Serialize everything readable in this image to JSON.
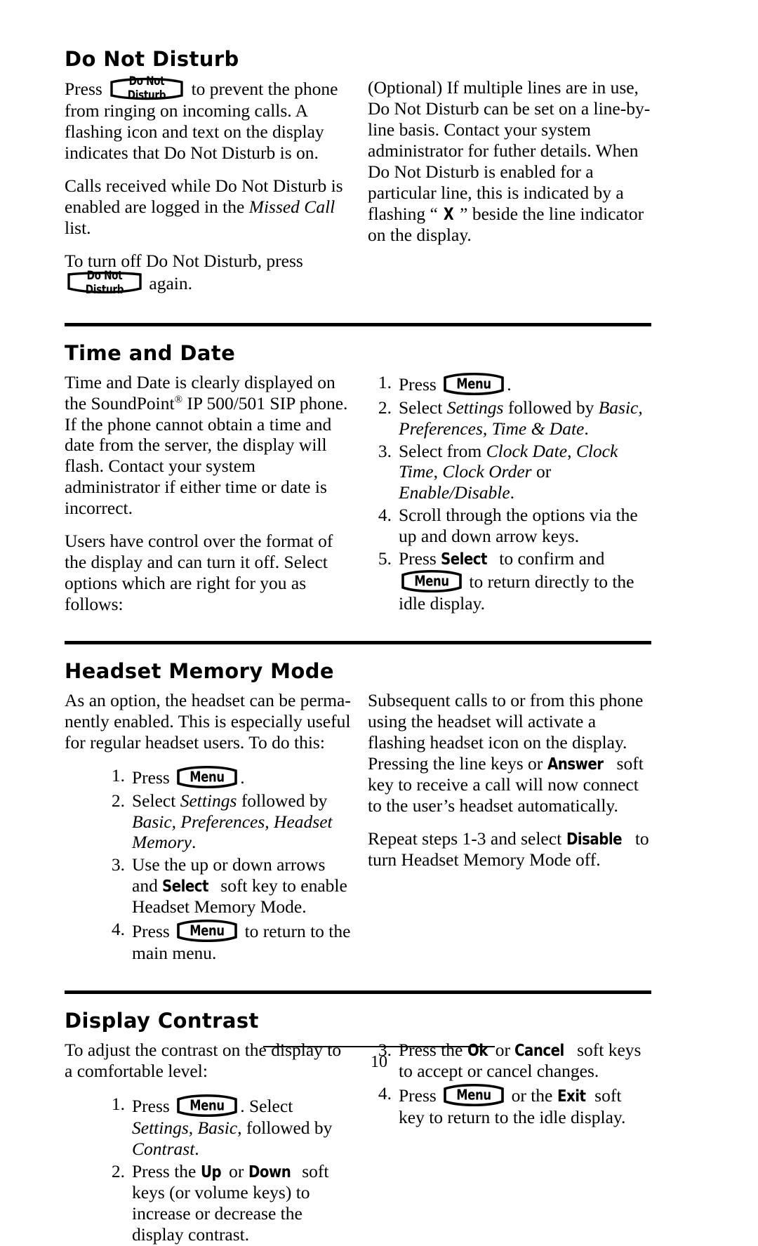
{
  "document": {
    "page_number": "10"
  },
  "keys": {
    "do_not_disturb": "Do Not Disturb",
    "menu": "Menu"
  },
  "sections": [
    {
      "id": "do-not-disturb",
      "heading": "Do Not Disturb",
      "has_rule_above": false,
      "left": {
        "p1_a": "Press ",
        "p1_b": " to prevent the phone from ringing on incoming calls.  A flashing icon and text on the display indicates that Do Not Disturb is on.",
        "p2_a": "Calls received while Do Not Disturb is enabled are logged in the ",
        "p2_i": "Missed Call",
        "p2_b": " list.",
        "p3_a": "To turn off Do Not Disturb, press ",
        "p3_b": " again."
      },
      "right": {
        "p1_a": "(Optional) If multiple lines are in use, Do Not Disturb can be set on a line-by-line basis.  Contact your system administrator for futher details.  When Do Not Disturb is enabled for a particular line, this is indicated by a flashing “ ",
        "p1_x": "X",
        "p1_b": " ” beside the line indicator on the display."
      }
    },
    {
      "id": "time-and-date",
      "heading": "Time and Date",
      "has_rule_above": true,
      "left": {
        "p1_a": "Time and Date is clearly displayed on the SoundPoint",
        "p1_reg": "®",
        "p1_b": " IP 500/501 SIP phone.  If the phone cannot obtain a time and date from the server, the display will flash.  Contact your system administrator if either time or date is incorrect.",
        "p2": "Users have control over the format of the display and can turn it off.  Select options which are right for you as follows:"
      },
      "right_steps": [
        {
          "num": "1.",
          "parts": [
            {
              "t": "text",
              "v": "Press "
            },
            {
              "t": "key",
              "v": "Menu"
            },
            {
              "t": "text",
              "v": "."
            }
          ]
        },
        {
          "num": "2.",
          "parts": [
            {
              "t": "text",
              "v": "Select "
            },
            {
              "t": "italic",
              "v": "Settings"
            },
            {
              "t": "text",
              "v": " followed by "
            },
            {
              "t": "italic",
              "v": "Basic, Preferences, Time & Date"
            },
            {
              "t": "text",
              "v": "."
            }
          ]
        },
        {
          "num": "3.",
          "parts": [
            {
              "t": "text",
              "v": "Select from "
            },
            {
              "t": "italic",
              "v": "Clock Date"
            },
            {
              "t": "text",
              "v": ", "
            },
            {
              "t": "italic",
              "v": "Clock Time"
            },
            {
              "t": "text",
              "v": ", "
            },
            {
              "t": "italic",
              "v": "Clock Order"
            },
            {
              "t": "text",
              "v": " or "
            },
            {
              "t": "italic",
              "v": "Enable/Disable"
            },
            {
              "t": "text",
              "v": "."
            }
          ]
        },
        {
          "num": "4.",
          "parts": [
            {
              "t": "text",
              "v": "Scroll through the options via the up and down arrow keys."
            }
          ]
        },
        {
          "num": "5.",
          "parts": [
            {
              "t": "text",
              "v": "Press "
            },
            {
              "t": "softkey",
              "v": "Select"
            },
            {
              "t": "text",
              "v": " to confirm and "
            },
            {
              "t": "key",
              "v": "Menu"
            },
            {
              "t": "text",
              "v": " to return directly to the idle display."
            }
          ]
        }
      ]
    },
    {
      "id": "headset-memory-mode",
      "heading": "Headset Memory Mode",
      "has_rule_above": true,
      "left": {
        "p1": "As an option, the headset can be perma-nently enabled.  This is especially useful for regular headset users.  To do this:"
      },
      "left_steps": [
        {
          "num": "1.",
          "parts": [
            {
              "t": "text",
              "v": "Press "
            },
            {
              "t": "key",
              "v": "Menu"
            },
            {
              "t": "text",
              "v": "."
            }
          ]
        },
        {
          "num": "2.",
          "parts": [
            {
              "t": "text",
              "v": "Select "
            },
            {
              "t": "italic",
              "v": "Settings"
            },
            {
              "t": "text",
              "v": " followed by "
            },
            {
              "t": "italic",
              "v": "Basic, Preferences, Headset Memory"
            },
            {
              "t": "text",
              "v": "."
            }
          ]
        },
        {
          "num": "3.",
          "parts": [
            {
              "t": "text",
              "v": "Use the up or down arrows and "
            },
            {
              "t": "softkey",
              "v": "Select"
            },
            {
              "t": "text",
              "v": " soft key to enable Headset Memory Mode."
            }
          ]
        },
        {
          "num": "4.",
          "parts": [
            {
              "t": "text",
              "v": "Press "
            },
            {
              "t": "key",
              "v": "Menu"
            },
            {
              "t": "text",
              "v": " to return to the main menu."
            }
          ]
        }
      ],
      "right": {
        "p1_a": "Subsequent calls to or from this phone using the headset will activate a flashing headset icon on the display.  Pressing the line keys or ",
        "p1_key": "Answer",
        "p1_b": " soft key to receive a call will now connect to the user’s headset automatically.",
        "p2_a": "Repeat steps 1-3 and select ",
        "p2_key": "Disable",
        "p2_b": " to turn Headset Memory Mode off."
      }
    },
    {
      "id": "display-contrast",
      "heading": "Display Contrast",
      "has_rule_above": true,
      "left": {
        "p1": "To adjust the contrast on the display to a comfortable level:"
      },
      "left_steps": [
        {
          "num": "1.",
          "parts": [
            {
              "t": "text",
              "v": "Press "
            },
            {
              "t": "key",
              "v": "Menu"
            },
            {
              "t": "text",
              "v": ".  Select "
            },
            {
              "t": "italic",
              "v": "Settings, Basic,"
            },
            {
              "t": "text",
              "v": " followed by "
            },
            {
              "t": "italic",
              "v": "Contrast"
            },
            {
              "t": "text",
              "v": "."
            }
          ]
        },
        {
          "num": "2.",
          "parts": [
            {
              "t": "text",
              "v": "Press the "
            },
            {
              "t": "softkey",
              "v": "Up"
            },
            {
              "t": "text",
              "v": " or "
            },
            {
              "t": "softkey",
              "v": "Down"
            },
            {
              "t": "text",
              "v": " soft keys (or volume keys) to increase or decrease the display contrast."
            }
          ]
        }
      ],
      "right_steps": [
        {
          "num": "3.",
          "parts": [
            {
              "t": "text",
              "v": "Press the "
            },
            {
              "t": "softkey",
              "v": "Ok"
            },
            {
              "t": "text",
              "v": " or "
            },
            {
              "t": "softkey",
              "v": "Cancel"
            },
            {
              "t": "text",
              "v": " soft keys to accept or cancel changes."
            }
          ]
        },
        {
          "num": "4.",
          "parts": [
            {
              "t": "text",
              "v": "Press "
            },
            {
              "t": "key",
              "v": "Menu"
            },
            {
              "t": "text",
              "v": " or the "
            },
            {
              "t": "softkey",
              "v": "Exit"
            },
            {
              "t": "text",
              "v": " soft key to return to the idle display."
            }
          ]
        }
      ]
    }
  ]
}
